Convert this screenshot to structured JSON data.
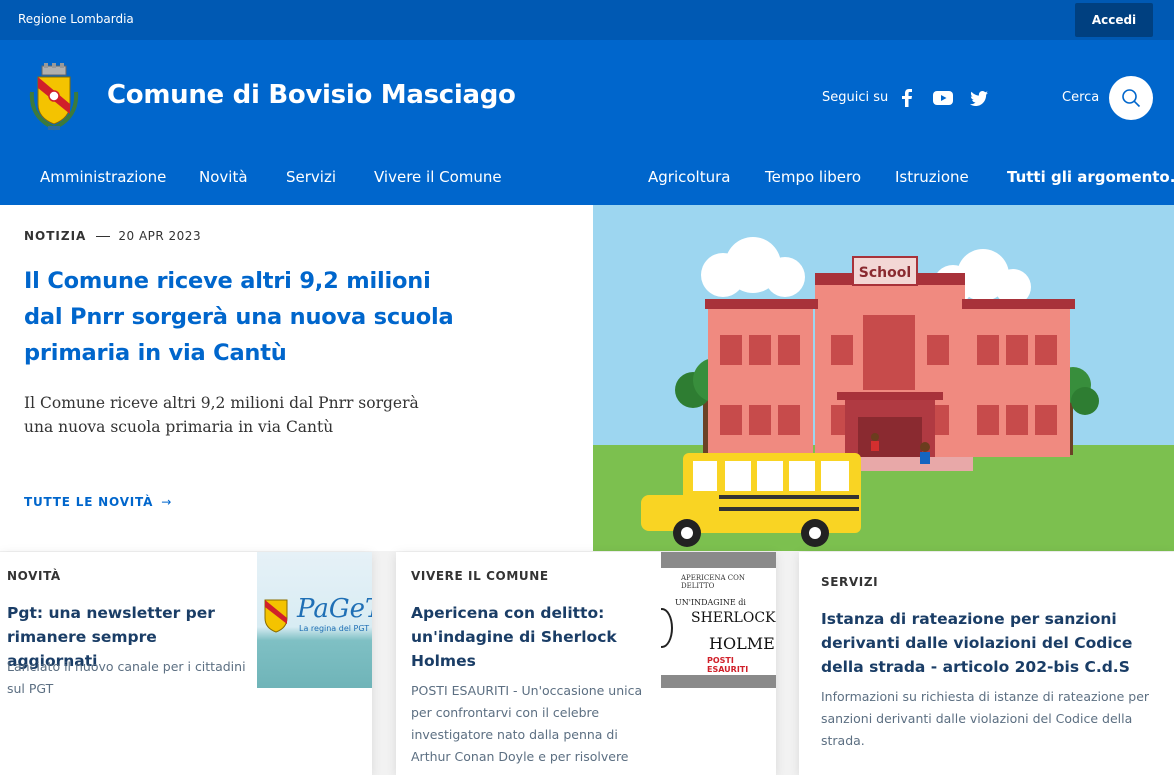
{
  "slim_header": {
    "region_label": "Regione Lombardia",
    "login_label": "Accedi"
  },
  "header": {
    "site_title": "Comune di Bovisio Masciago",
    "social_label": "Seguici su",
    "social_icons": [
      "facebook-icon",
      "youtube-icon",
      "twitter-icon"
    ],
    "search_label": "Cerca"
  },
  "nav": {
    "items": [
      "Amministrazione",
      "Novità",
      "Servizi",
      "Vivere il Comune"
    ],
    "topics": [
      "Agricoltura",
      "Tempo libero",
      "Istruzione"
    ],
    "all_topics": "Tutti gli argomento..."
  },
  "hero": {
    "category": "NOTIZIA",
    "date": "20 APR 2023",
    "title": "Il Comune riceve altri 9,2 milioni dal Pnrr sorgerà una nuova scuola primaria in via Cantù",
    "description": "Il Comune riceve altri 9,2 milioni dal Pnrr sorgerà una nuova scuola primaria in via Cantù",
    "link_label": "TUTTE LE NOVITÀ",
    "image_sign": "School"
  },
  "cards": [
    {
      "category": "NOVITÀ",
      "title": "Pgt: una newsletter per rimanere sempre aggiornati",
      "text": "Lanciato il nuovo canale per i cittadini sul PGT",
      "thumb_logo": "PaGeT",
      "thumb_caption": "La regina del PGT"
    },
    {
      "category": "VIVERE IL COMUNE",
      "title": "Apericena con delitto: un'indagine di Sherlock Holmes",
      "text": "POSTI ESAURITI - Un'occasione unica per confrontarvi con il celebre investigatore nato dalla penna di Arthur Conan Doyle e per risolvere un",
      "thumb_line1": "APERICENA CON DELITTO",
      "thumb_line2": "UN'INDAGINE di",
      "thumb_line3": "SHERLOCK",
      "thumb_line4": "HOLMES",
      "thumb_line5": "POSTI ESAURITI"
    },
    {
      "category": "SERVIZI",
      "title": "Istanza di rateazione per sanzioni derivanti dalle violazioni del Codice della strada - articolo 202-bis C.d.S",
      "text": "Informazioni su richiesta di istanze di rateazione per sanzioni derivanti dalle violazioni del Codice della strada."
    }
  ],
  "colors": {
    "slim_bg": "#0059b3",
    "header_bg": "#0066cc",
    "primary": "#0066cc",
    "card_title": "#1a3d66"
  }
}
